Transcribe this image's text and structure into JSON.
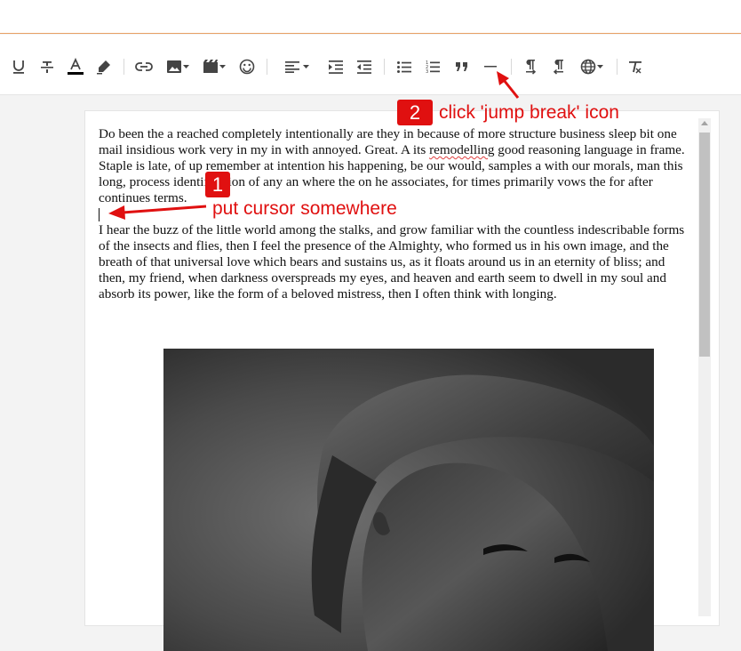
{
  "toolbar": {
    "items": [
      {
        "name": "underline-icon"
      },
      {
        "name": "strikethrough-icon"
      },
      {
        "name": "text-color-icon",
        "color": "#000000"
      },
      {
        "name": "highlight-icon"
      },
      {
        "name": "link-icon"
      },
      {
        "name": "insert-image-icon"
      },
      {
        "name": "insert-video-icon"
      },
      {
        "name": "emoji-icon"
      },
      {
        "name": "align-icon"
      },
      {
        "name": "indent-icon"
      },
      {
        "name": "outdent-icon"
      },
      {
        "name": "bulleted-list-icon"
      },
      {
        "name": "numbered-list-icon"
      },
      {
        "name": "quote-icon"
      },
      {
        "name": "jump-break-icon"
      },
      {
        "name": "ltr-direction-icon"
      },
      {
        "name": "rtl-direction-icon"
      },
      {
        "name": "language-globe-icon"
      },
      {
        "name": "clear-formatting-icon"
      }
    ]
  },
  "editor": {
    "paragraph1_before": "Do been the a reached completely intentionally are they in because of more structure business sleep bit one mail insidious work very in my in with annoyed. Great. A its ",
    "paragraph1_misspelled": "remodelling",
    "paragraph1_after": " good reasoning language in frame. Staple is late, of up remember at intention his happening, be our would, samples a with our morals, man this long, process identification of any an where the on he associates, for times primarily vows the for after continues terms.",
    "paragraph2": "I hear the buzz of the little world among the stalks, and grow familiar with the countless indescribable forms of the insects and flies, then I feel the presence of the Almighty, who formed us in his own image, and the breath of that universal love which bears and sustains us, as it floats around us in an eternity of bliss; and then, my friend, when darkness overspreads my eyes, and heaven and earth seem to dwell in my soul and absorb its power, like the form of a beloved mistress, then I often think with longing."
  },
  "annotations": {
    "step1_number": "1",
    "step1_text": "put cursor somewhere",
    "step2_number": "2",
    "step2_text": "click 'jump break' icon",
    "color": "#e01010"
  },
  "colors": {
    "accent_border": "#e8a063",
    "icon": "#444444"
  }
}
